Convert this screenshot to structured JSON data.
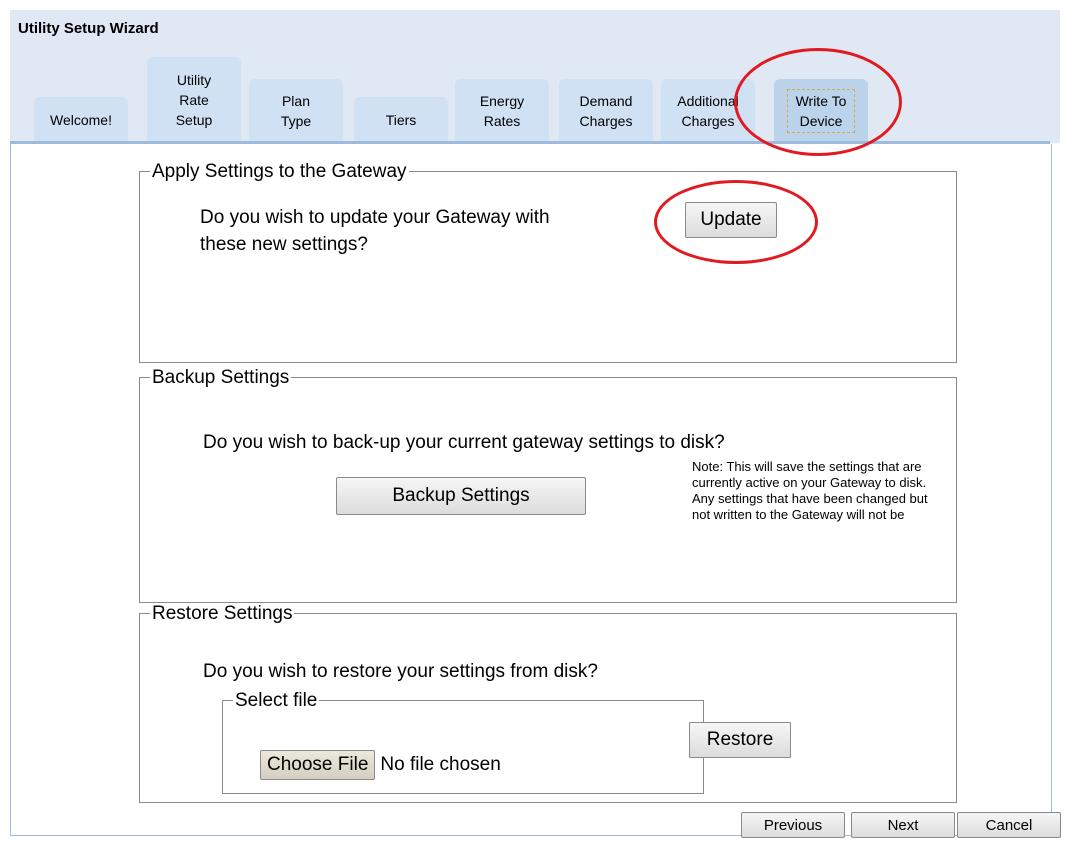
{
  "window": {
    "title": "Utility Setup Wizard"
  },
  "tabs": [
    {
      "label": "Welcome!"
    },
    {
      "label": "Utility\nRate\nSetup"
    },
    {
      "label": "Plan\nType"
    },
    {
      "label": "Tiers"
    },
    {
      "label": "Energy\nRates"
    },
    {
      "label": "Demand\nCharges"
    },
    {
      "label": "Additional\nCharges"
    },
    {
      "label": "Write To\nDevice",
      "active": true
    }
  ],
  "apply": {
    "legend": "Apply Settings to the Gateway",
    "question": "Do you wish to update your Gateway with\nthese new settings?",
    "button": "Update"
  },
  "backup": {
    "legend": "Backup Settings",
    "question": "Do you wish to back-up your current gateway settings to disk?",
    "button": "Backup Settings",
    "note": "Note: This will save the settings that are currently active on your Gateway to disk. Any settings that have been changed but not written to the Gateway will not be"
  },
  "restore": {
    "legend": "Restore Settings",
    "question": "Do you wish to restore your settings from disk?",
    "select_legend": "Select file",
    "choose_button": "Choose File",
    "file_status": "No file chosen",
    "button": "Restore"
  },
  "footer": {
    "previous": "Previous",
    "next": "Next",
    "cancel": "Cancel"
  },
  "annotation_color": "#e11a22"
}
